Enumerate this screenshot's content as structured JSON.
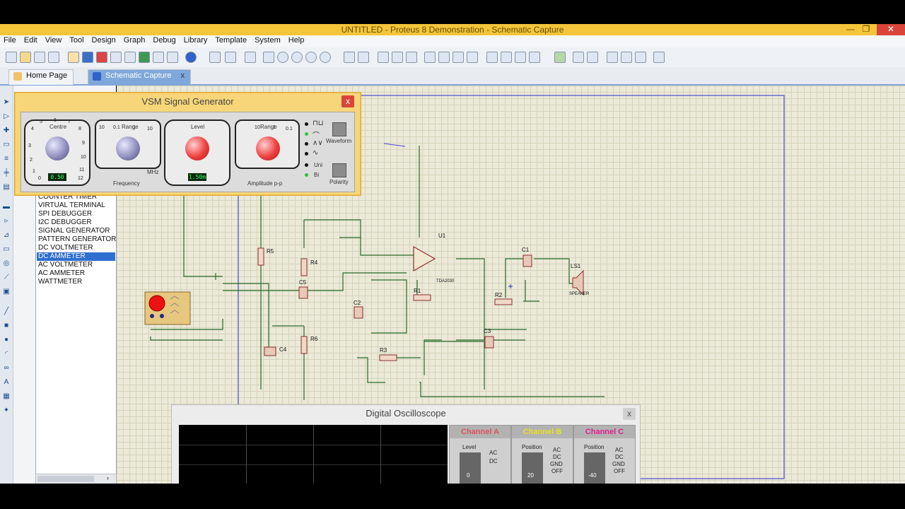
{
  "window": {
    "title": "UNTITLED - Proteus 8 Demonstration - Schematic Capture",
    "min": "—",
    "restore": "❐",
    "close": "✕"
  },
  "menu": [
    "File",
    "Edit",
    "View",
    "Tool",
    "Design",
    "Graph",
    "Debug",
    "Library",
    "Template",
    "System",
    "Help"
  ],
  "tabs": [
    {
      "label": "Home Page"
    },
    {
      "label": "Schematic Capture",
      "close": "x"
    }
  ],
  "devices": [
    "COUNTER TIMER",
    "VIRTUAL TERMINAL",
    "SPI DEBUGGER",
    "I2C DEBUGGER",
    "SIGNAL GENERATOR",
    "PATTERN GENERATOR",
    "DC VOLTMETER",
    "DC AMMETER",
    "AC VOLTMETER",
    "AC AMMETER",
    "WATTMETER"
  ],
  "selected_device_index": 7,
  "signal_generator": {
    "title": "VSM Signal Generator",
    "close": "x",
    "centre_label": "Centre",
    "range_label": "Range",
    "level_label": "Level",
    "frequency_label": "Frequency",
    "amplitude_label": "Amplitude p-p",
    "waveform_label": "Waveform",
    "polarity_label": "Polarity",
    "uni": "Uni",
    "bi": "Bi",
    "freq_lcd": "0.50",
    "amp_lcd": "1.50m",
    "dial_scale": [
      "5",
      "6",
      "7",
      "8",
      "9",
      "10",
      "11",
      "12",
      "4",
      "3",
      "2",
      "1",
      "0"
    ],
    "range_scale": [
      "10",
      "0.1",
      "1",
      "10",
      "1",
      "0.1"
    ],
    "mhz": "MHz"
  },
  "schematic": {
    "labels": [
      "U1",
      "R5",
      "R4",
      "R6",
      "C5",
      "C4",
      "C2",
      "C3",
      "C1",
      "R1",
      "R2",
      "R3",
      "LS1",
      "TDA2030",
      "SPEAKER"
    ]
  },
  "oscilloscope": {
    "title": "Digital Oscilloscope",
    "close": "x",
    "channel_a": "Channel A",
    "channel_b": "Channel B",
    "channel_c": "Channel C",
    "level": "Level",
    "position": "Position",
    "ac": "AC",
    "dc": "DC",
    "gnd": "GND",
    "off": "OFF",
    "a_value": "0",
    "b_value": "20",
    "c_value": "-40"
  }
}
